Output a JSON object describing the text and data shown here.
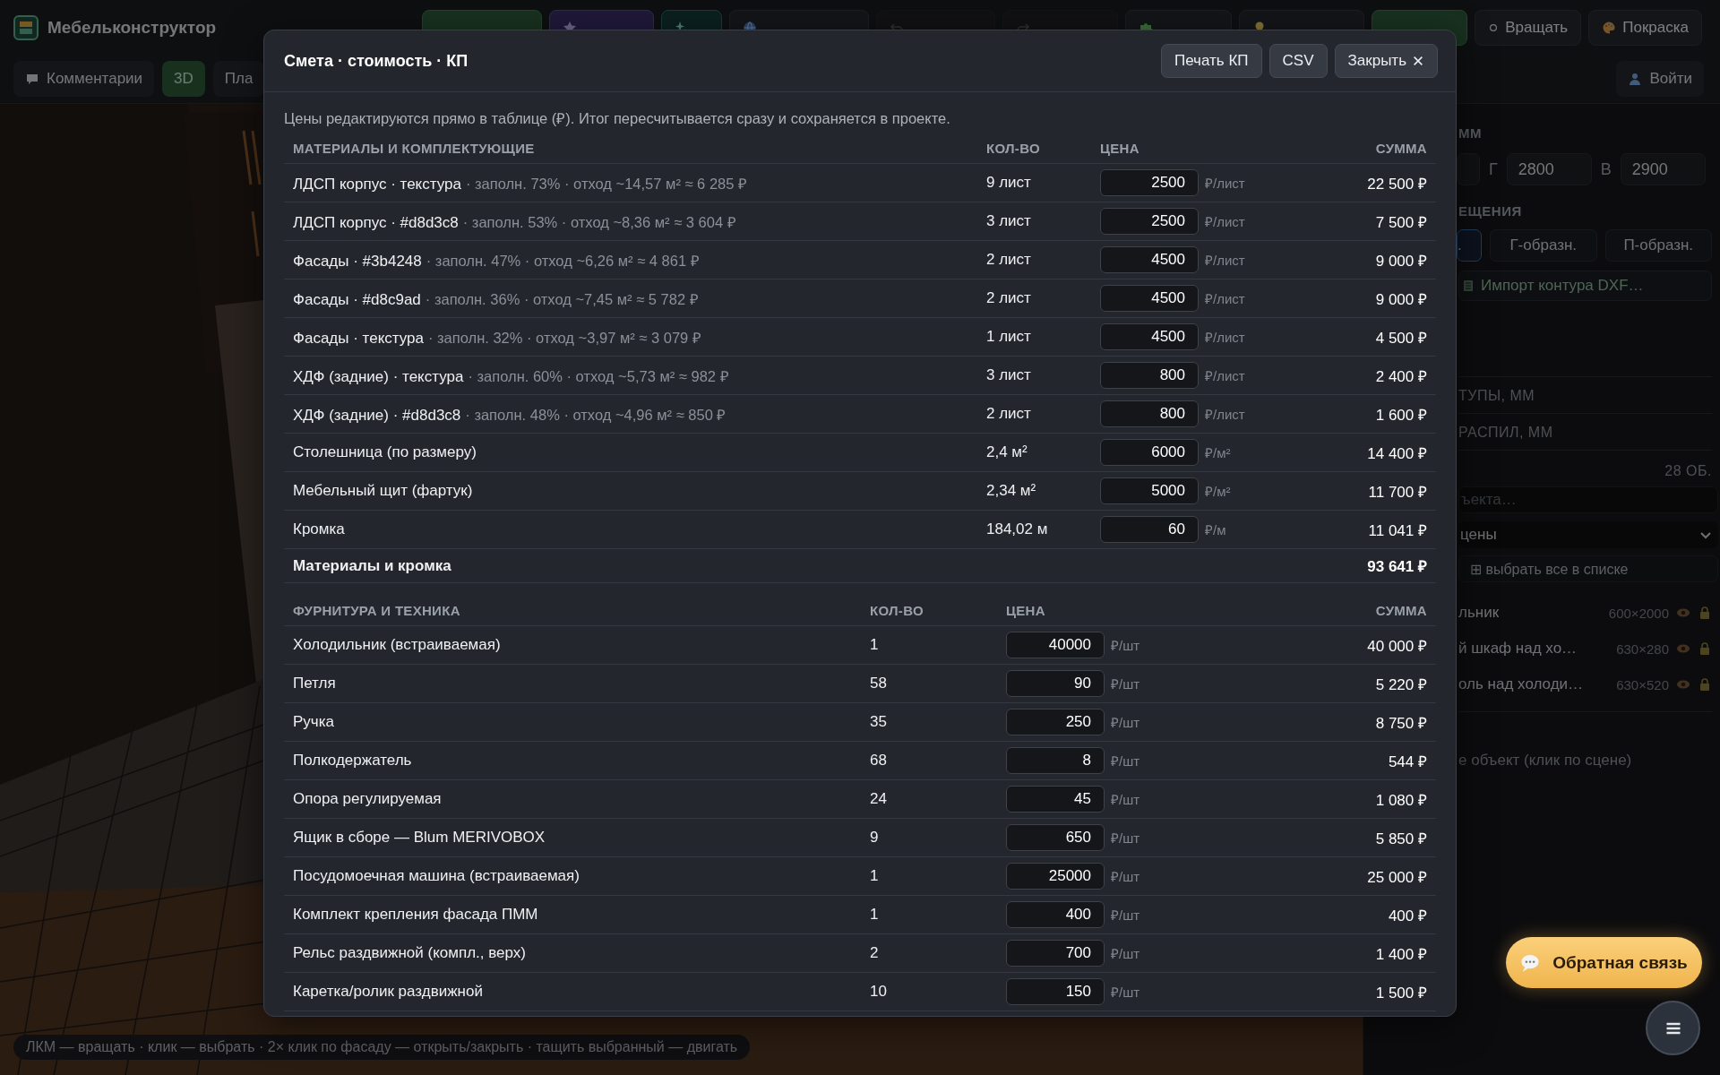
{
  "app": {
    "title": "Мебельконструктор"
  },
  "toolbar": [
    {
      "label": "Вращать"
    },
    {
      "label": "Покраска"
    }
  ],
  "view_tabs": [
    {
      "label": "Комментарии",
      "selected": false
    },
    {
      "label": "3D",
      "selected": true
    },
    {
      "label": "Пла",
      "selected": false
    }
  ],
  "login": {
    "label": "Войти"
  },
  "viewport": {
    "kind": "picture",
    "hint": "ЛКМ — вращать · клик — выбрать · 2× клик по фасаду — открыть/закрыть · тащить выбранный — двигать"
  },
  "side_panel": {
    "room_size": {
      "title": "ММ",
      "fields": [
        {
          "label": "Г",
          "value": "2800"
        },
        {
          "label": "В",
          "value": "2900"
        }
      ]
    },
    "room_shape": {
      "title": "ЕЩЕНИЯ",
      "options": [
        {
          "label": ".",
          "selected": true
        },
        {
          "label": "Г-образн.",
          "selected": false
        },
        {
          "label": "П-образн.",
          "selected": false
        }
      ]
    },
    "import_button": "Импорт контура DXF…",
    "sections": [
      "ТУПЫ, ММ",
      "РАСПИЛ, ММ"
    ],
    "objects": {
      "count": "28 ОБ.",
      "search_placeholder": "ъекта…",
      "filter": "цены",
      "select_all": "⊞ выбрать все в списке",
      "items": [
        {
          "name": "льник",
          "size": "600×2000"
        },
        {
          "name": "й шкаф над хо…",
          "size": "630×280"
        },
        {
          "name": "оль над холоди…",
          "size": "630×520"
        }
      ],
      "hint": "е объект (клик по сцене)"
    }
  },
  "estimate_dialog": {
    "title": "Смета · стоимость · КП",
    "buttons": [
      "Печать КП",
      "CSV",
      "Закрыть"
    ],
    "description": "Цены редактируются прямо в таблице (₽). Итог пересчитывается сразу и сохраняется в проекте.",
    "materials": {
      "columns": [
        "МАТЕРИАЛЫ И КОМПЛЕКТУЮЩИЕ",
        "КОЛ-ВО",
        "ЦЕНА",
        "СУММА"
      ],
      "rows": [
        {
          "name": "ЛДСП корпус · текстура",
          "detail": "· заполн. 73% · отход ~14,57 м² ≈ 6 285 ₽",
          "qty": "9 лист",
          "price": "2500",
          "unit": "₽/лист",
          "sum": "22 500 ₽"
        },
        {
          "name": "ЛДСП корпус · #d8d3c8",
          "detail": "· заполн. 53% · отход ~8,36 м² ≈ 3 604 ₽",
          "qty": "3 лист",
          "price": "2500",
          "unit": "₽/лист",
          "sum": "7 500 ₽"
        },
        {
          "name": "Фасады · #3b4248",
          "detail": "· заполн. 47% · отход ~6,26 м² ≈ 4 861 ₽",
          "qty": "2 лист",
          "price": "4500",
          "unit": "₽/лист",
          "sum": "9 000 ₽"
        },
        {
          "name": "Фасады · #d8c9ad",
          "detail": "· заполн. 36% · отход ~7,45 м² ≈ 5 782 ₽",
          "qty": "2 лист",
          "price": "4500",
          "unit": "₽/лист",
          "sum": "9 000 ₽"
        },
        {
          "name": "Фасады · текстура",
          "detail": "· заполн. 32% · отход ~3,97 м² ≈ 3 079 ₽",
          "qty": "1 лист",
          "price": "4500",
          "unit": "₽/лист",
          "sum": "4 500 ₽"
        },
        {
          "name": "ХДФ (задние) · текстура",
          "detail": "· заполн. 60% · отход ~5,73 м² ≈ 982 ₽",
          "qty": "3 лист",
          "price": "800",
          "unit": "₽/лист",
          "sum": "2 400 ₽"
        },
        {
          "name": "ХДФ (задние) · #d8d3c8",
          "detail": "· заполн. 48% · отход ~4,96 м² ≈ 850 ₽",
          "qty": "2 лист",
          "price": "800",
          "unit": "₽/лист",
          "sum": "1 600 ₽"
        },
        {
          "name": "Столешница (по размеру)",
          "qty": "2,4 м²",
          "price": "6000",
          "unit": "₽/м²",
          "sum": "14 400 ₽"
        },
        {
          "name": "Мебельный щит (фартук)",
          "qty": "2,34 м²",
          "price": "5000",
          "unit": "₽/м²",
          "sum": "11 700 ₽"
        },
        {
          "name": "Кромка",
          "qty": "184,02 м",
          "price": "60",
          "unit": "₽/м",
          "sum": "11 041 ₽"
        }
      ],
      "total": {
        "label": "Материалы и кромка",
        "sum": "93 641 ₽"
      }
    },
    "hardware": {
      "columns": [
        "ФУРНИТУРА И ТЕХНИКА",
        "КОЛ-ВО",
        "ЦЕНА",
        "СУММА"
      ],
      "rows": [
        {
          "name": "Холодильник (встраиваемая)",
          "qty": "1",
          "price": "40000",
          "unit": "₽/шт",
          "sum": "40 000 ₽"
        },
        {
          "name": "Петля",
          "qty": "58",
          "price": "90",
          "unit": "₽/шт",
          "sum": "5 220 ₽"
        },
        {
          "name": "Ручка",
          "qty": "35",
          "price": "250",
          "unit": "₽/шт",
          "sum": "8 750 ₽"
        },
        {
          "name": "Полкодержатель",
          "qty": "68",
          "price": "8",
          "unit": "₽/шт",
          "sum": "544 ₽"
        },
        {
          "name": "Опора регулируемая",
          "qty": "24",
          "price": "45",
          "unit": "₽/шт",
          "sum": "1 080 ₽"
        },
        {
          "name": "Ящик в сборе — Blum MERIVOBOX",
          "qty": "9",
          "price": "650",
          "unit": "₽/шт",
          "sum": "5 850 ₽"
        },
        {
          "name": "Посудомоечная машина (встраиваемая)",
          "qty": "1",
          "price": "25000",
          "unit": "₽/шт",
          "sum": "25 000 ₽"
        },
        {
          "name": "Комплект крепления фасада ПММ",
          "qty": "1",
          "price": "400",
          "unit": "₽/шт",
          "sum": "400 ₽"
        },
        {
          "name": "Рельс раздвижной (компл., верх)",
          "qty": "2",
          "price": "700",
          "unit": "₽/шт",
          "sum": "1 400 ₽"
        },
        {
          "name": "Каретка/ролик раздвижной",
          "qty": "10",
          "price": "150",
          "unit": "₽/шт",
          "sum": "1 500 ₽"
        }
      ]
    }
  },
  "feedback_button": {
    "label": "Обратная связь"
  }
}
